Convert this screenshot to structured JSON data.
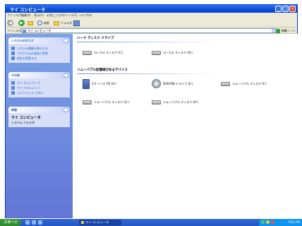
{
  "window": {
    "title": "マイ コンピュータ"
  },
  "menu": [
    "ファイル(F)",
    "編集(E)",
    "表示(V)",
    "お気に入り(A)",
    "ツール(T)",
    "ヘルプ(H)"
  ],
  "toolbar": {
    "back_label": "",
    "search_label": "検索",
    "folders_label": "フォルダ"
  },
  "address": {
    "label": "アドレス(D)",
    "value": "マイ コンピュータ",
    "go_label": "移動",
    "links_label": "リンク"
  },
  "taskpane": {
    "system_tasks": {
      "title": "システムのタスク",
      "items": [
        "システム情報を表示する",
        "プログラムの追加と削除",
        "設定を変更する"
      ]
    },
    "other_places": {
      "title": "その他",
      "items": [
        "マイ ネットワーク",
        "マイ ドキュメント",
        "コントロール パネル"
      ]
    },
    "details": {
      "title": "詳細",
      "name": "マイ コンピュータ",
      "sub": "システム フォルダ"
    }
  },
  "content": {
    "hdd_group": "ハード ディスク ドライブ",
    "hdd": [
      "ローカル ディスク (C:)",
      "ローカル ディスク (D:)"
    ],
    "removable_group": "リムーバブル記憶域があるデバイス",
    "removable_row1": [
      "3.5 インチ FD (A:)",
      "DVD-RW ドライブ (E:)",
      "リムーバブル ディスク (F:)"
    ],
    "removable_row2": [
      "リムーバブル ディスク (G:)",
      "リムーバブル ディスク (H:)"
    ]
  },
  "taskbar": {
    "start_label": "スタート",
    "task_label": "マイ コンピュータ",
    "clock": "9:01 PM"
  },
  "colors": {
    "title_blue": "#0b4fd8",
    "taskpane_blue": "#7ba2e7",
    "start_green": "#3c9a3c"
  }
}
